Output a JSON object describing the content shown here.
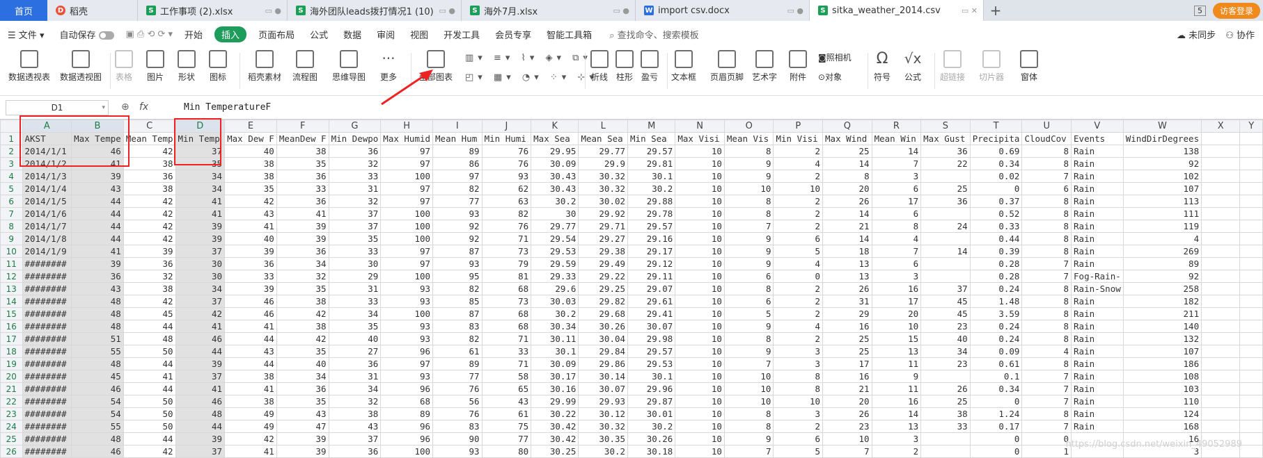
{
  "tabs": {
    "home": "首页",
    "files": [
      {
        "label": "稻壳",
        "kind": "d"
      },
      {
        "label": "工作事项 (2).xlsx",
        "kind": "s"
      },
      {
        "label": "海外团队leads拨打情况1 (10)",
        "kind": "s"
      },
      {
        "label": "海外7月.xlsx",
        "kind": "s"
      },
      {
        "label": "import csv.docx",
        "kind": "w"
      },
      {
        "label": "sitka_weather_2014.csv",
        "kind": "s"
      }
    ],
    "badge": "5",
    "visitor": "访客登录"
  },
  "menu": {
    "file": "文件",
    "autosave": "自动保存",
    "items": [
      "开始",
      "插入",
      "页面布局",
      "公式",
      "数据",
      "审阅",
      "视图",
      "开发工具",
      "会员专享",
      "智能工具箱"
    ],
    "search": "查找命令、搜索模板",
    "right": [
      "未同步",
      "协作"
    ]
  },
  "ribbon": {
    "buttons": [
      "数据透视表",
      "数据透视图",
      "表格",
      "图片",
      "形状",
      "图标",
      "稻壳素材",
      "流程图",
      "思维导图",
      "更多",
      "全部图表",
      "折线",
      "柱形",
      "盈亏",
      "文本框",
      "页眉页脚",
      "艺术字",
      "附件",
      "照相机",
      "对象",
      "符号",
      "公式",
      "超链接",
      "切片器",
      "窗体"
    ]
  },
  "formula": {
    "cell": "D1",
    "content": "Min TemperatureF"
  },
  "columns": [
    "A",
    "B",
    "C",
    "D",
    "E",
    "F",
    "G",
    "H",
    "I",
    "J",
    "K",
    "L",
    "M",
    "N",
    "O",
    "P",
    "Q",
    "R",
    "S",
    "T",
    "U",
    "V",
    "W",
    "X",
    "Y"
  ],
  "rows": [
    [
      "AKST",
      "Max Tempe",
      "Mean Temp",
      "Min Temp",
      "Max Dew F",
      "MeanDew F",
      "Min Dewpo",
      "Max Humid",
      "Mean Hum",
      "Min Humi",
      "Max Sea",
      "Mean Sea",
      "Min Sea",
      "Max Visi",
      "Mean Vis",
      "Min Visi",
      "Max Wind",
      "Mean Win",
      "Max Gust",
      "Precipita",
      "CloudCov",
      "Events",
      "WindDirDegrees"
    ],
    [
      "2014/1/1",
      "46",
      "42",
      "37",
      "40",
      "38",
      "36",
      "97",
      "89",
      "76",
      "29.95",
      "29.77",
      "29.57",
      "10",
      "8",
      "2",
      "25",
      "14",
      "36",
      "0.69",
      "8",
      "Rain",
      "138"
    ],
    [
      "2014/1/2",
      "41",
      "38",
      "35",
      "38",
      "35",
      "32",
      "97",
      "86",
      "76",
      "30.09",
      "29.9",
      "29.81",
      "10",
      "9",
      "4",
      "14",
      "7",
      "22",
      "0.34",
      "8",
      "Rain",
      "92"
    ],
    [
      "2014/1/3",
      "39",
      "36",
      "34",
      "38",
      "36",
      "33",
      "100",
      "97",
      "93",
      "30.43",
      "30.32",
      "30.1",
      "10",
      "9",
      "2",
      "8",
      "3",
      "",
      "0.02",
      "7",
      "Rain",
      "102"
    ],
    [
      "2014/1/4",
      "43",
      "38",
      "34",
      "35",
      "33",
      "31",
      "97",
      "82",
      "62",
      "30.43",
      "30.32",
      "30.2",
      "10",
      "10",
      "10",
      "20",
      "6",
      "25",
      "0",
      "6",
      "Rain",
      "107"
    ],
    [
      "2014/1/5",
      "44",
      "42",
      "41",
      "42",
      "36",
      "32",
      "97",
      "77",
      "63",
      "30.2",
      "30.02",
      "29.88",
      "10",
      "8",
      "2",
      "26",
      "17",
      "36",
      "0.37",
      "8",
      "Rain",
      "113"
    ],
    [
      "2014/1/6",
      "44",
      "42",
      "41",
      "43",
      "41",
      "37",
      "100",
      "93",
      "82",
      "30",
      "29.92",
      "29.78",
      "10",
      "8",
      "2",
      "14",
      "6",
      "",
      "0.52",
      "8",
      "Rain",
      "111"
    ],
    [
      "2014/1/7",
      "44",
      "42",
      "39",
      "41",
      "39",
      "37",
      "100",
      "92",
      "76",
      "29.77",
      "29.71",
      "29.57",
      "10",
      "7",
      "2",
      "21",
      "8",
      "24",
      "0.33",
      "8",
      "Rain",
      "119"
    ],
    [
      "2014/1/8",
      "44",
      "42",
      "39",
      "40",
      "39",
      "35",
      "100",
      "92",
      "71",
      "29.54",
      "29.27",
      "29.16",
      "10",
      "9",
      "6",
      "14",
      "4",
      "",
      "0.44",
      "8",
      "Rain",
      "4"
    ],
    [
      "2014/1/9",
      "41",
      "39",
      "37",
      "39",
      "36",
      "33",
      "97",
      "87",
      "73",
      "29.53",
      "29.38",
      "29.17",
      "10",
      "9",
      "5",
      "18",
      "7",
      "14",
      "0.39",
      "8",
      "Rain",
      "269"
    ],
    [
      "########",
      "39",
      "36",
      "30",
      "36",
      "34",
      "30",
      "97",
      "93",
      "79",
      "29.59",
      "29.49",
      "29.12",
      "10",
      "9",
      "4",
      "13",
      "6",
      "",
      "0.28",
      "7",
      "Rain",
      "89"
    ],
    [
      "########",
      "36",
      "32",
      "30",
      "33",
      "32",
      "29",
      "100",
      "95",
      "81",
      "29.33",
      "29.22",
      "29.11",
      "10",
      "6",
      "0",
      "13",
      "3",
      "",
      "0.28",
      "7",
      "Fog-Rain-",
      "92"
    ],
    [
      "########",
      "43",
      "38",
      "34",
      "39",
      "35",
      "31",
      "93",
      "82",
      "68",
      "29.6",
      "29.25",
      "29.07",
      "10",
      "8",
      "2",
      "26",
      "16",
      "37",
      "0.24",
      "8",
      "Rain-Snow",
      "258"
    ],
    [
      "########",
      "48",
      "42",
      "37",
      "46",
      "38",
      "33",
      "93",
      "85",
      "73",
      "30.03",
      "29.82",
      "29.61",
      "10",
      "6",
      "2",
      "31",
      "17",
      "45",
      "1.48",
      "8",
      "Rain",
      "182"
    ],
    [
      "########",
      "48",
      "45",
      "42",
      "46",
      "42",
      "34",
      "100",
      "87",
      "68",
      "30.2",
      "29.68",
      "29.41",
      "10",
      "5",
      "2",
      "29",
      "20",
      "45",
      "3.59",
      "8",
      "Rain",
      "211"
    ],
    [
      "########",
      "48",
      "44",
      "41",
      "41",
      "38",
      "35",
      "93",
      "83",
      "68",
      "30.34",
      "30.26",
      "30.07",
      "10",
      "9",
      "4",
      "16",
      "10",
      "23",
      "0.24",
      "8",
      "Rain",
      "140"
    ],
    [
      "########",
      "51",
      "48",
      "46",
      "44",
      "42",
      "40",
      "93",
      "82",
      "71",
      "30.11",
      "30.04",
      "29.98",
      "10",
      "8",
      "2",
      "25",
      "15",
      "40",
      "0.24",
      "8",
      "Rain",
      "132"
    ],
    [
      "########",
      "55",
      "50",
      "44",
      "43",
      "35",
      "27",
      "96",
      "61",
      "33",
      "30.1",
      "29.84",
      "29.57",
      "10",
      "9",
      "3",
      "25",
      "13",
      "34",
      "0.09",
      "4",
      "Rain",
      "107"
    ],
    [
      "########",
      "48",
      "44",
      "39",
      "44",
      "40",
      "36",
      "97",
      "89",
      "71",
      "30.09",
      "29.86",
      "29.53",
      "10",
      "7",
      "3",
      "17",
      "11",
      "23",
      "0.61",
      "8",
      "Rain",
      "186"
    ],
    [
      "########",
      "45",
      "41",
      "37",
      "38",
      "34",
      "31",
      "93",
      "77",
      "58",
      "30.17",
      "30.14",
      "30.1",
      "10",
      "10",
      "8",
      "16",
      "9",
      "",
      "0.1",
      "7",
      "Rain",
      "108"
    ],
    [
      "########",
      "46",
      "44",
      "41",
      "41",
      "36",
      "34",
      "96",
      "76",
      "65",
      "30.16",
      "30.07",
      "29.96",
      "10",
      "10",
      "8",
      "21",
      "11",
      "26",
      "0.34",
      "7",
      "Rain",
      "103"
    ],
    [
      "########",
      "54",
      "50",
      "46",
      "38",
      "35",
      "32",
      "68",
      "56",
      "43",
      "29.99",
      "29.93",
      "29.87",
      "10",
      "10",
      "10",
      "20",
      "16",
      "25",
      "0",
      "7",
      "Rain",
      "110"
    ],
    [
      "########",
      "54",
      "50",
      "48",
      "49",
      "43",
      "38",
      "89",
      "76",
      "61",
      "30.22",
      "30.12",
      "30.01",
      "10",
      "8",
      "3",
      "26",
      "14",
      "38",
      "1.24",
      "8",
      "Rain",
      "124"
    ],
    [
      "########",
      "55",
      "50",
      "44",
      "49",
      "47",
      "43",
      "96",
      "83",
      "75",
      "30.42",
      "30.32",
      "30.2",
      "10",
      "8",
      "2",
      "23",
      "13",
      "33",
      "0.17",
      "7",
      "Rain",
      "168"
    ],
    [
      "########",
      "48",
      "44",
      "39",
      "42",
      "39",
      "37",
      "96",
      "90",
      "77",
      "30.42",
      "30.35",
      "30.26",
      "10",
      "9",
      "6",
      "10",
      "3",
      "",
      "0",
      "0",
      "",
      "16"
    ],
    [
      "########",
      "46",
      "42",
      "37",
      "41",
      "39",
      "36",
      "100",
      "93",
      "80",
      "30.25",
      "30.2",
      "30.18",
      "10",
      "7",
      "5",
      "7",
      "2",
      "",
      "0",
      "1",
      "",
      "3"
    ]
  ],
  "watermark": "https://blog.csdn.net/weixin_49052989"
}
